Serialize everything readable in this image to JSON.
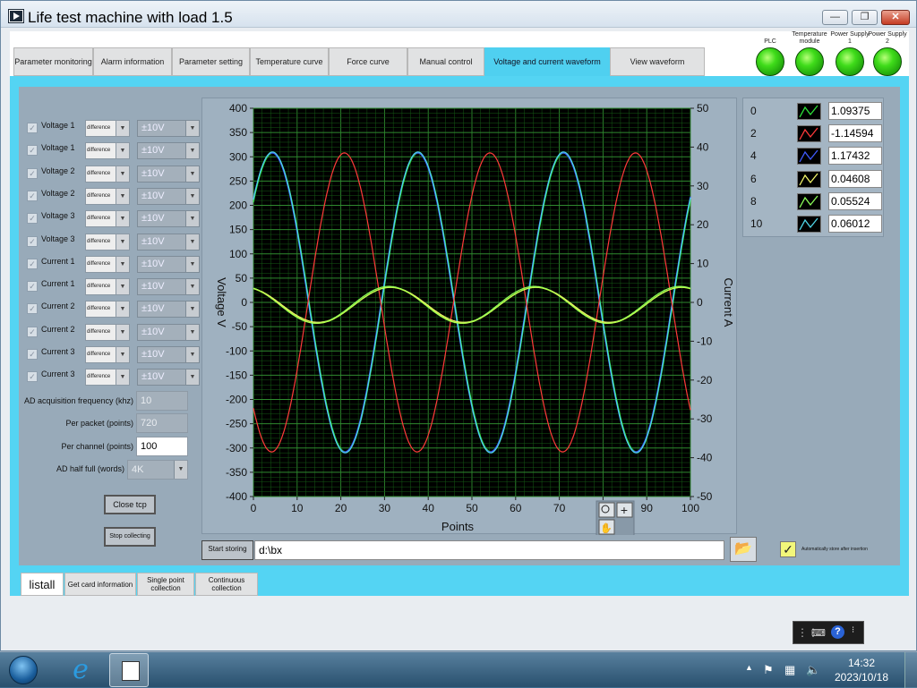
{
  "window": {
    "title": "Life test machine with load 1.5",
    "min": "—",
    "max": "❐",
    "close": "✕"
  },
  "tabs": [
    {
      "label": "Parameter monitoring"
    },
    {
      "label": "Alarm information"
    },
    {
      "label": "Parameter setting"
    },
    {
      "label": "Temperature curve"
    },
    {
      "label": "Force curve"
    },
    {
      "label": "Manual control"
    },
    {
      "label": "Voltage and current waveform"
    },
    {
      "label": "View waveform"
    }
  ],
  "indicators": [
    {
      "label": "PLC",
      "color": "#3fdc1a"
    },
    {
      "label": "Temperature module",
      "color": "#3fdc1a"
    },
    {
      "label": "Power Supply 1",
      "color": "#3fdc1a"
    },
    {
      "label": "Power Supply 2",
      "color": "#3fdc1a"
    }
  ],
  "channels": [
    {
      "label": "Voltage 1",
      "mode": "difference",
      "range": "±10V"
    },
    {
      "label": "Voltage 1",
      "mode": "difference",
      "range": "±10V"
    },
    {
      "label": "Voltage 2",
      "mode": "difference",
      "range": "±10V"
    },
    {
      "label": "Voltage 2",
      "mode": "difference",
      "range": "±10V"
    },
    {
      "label": "Voltage 3",
      "mode": "difference",
      "range": "±10V"
    },
    {
      "label": "Voltage 3",
      "mode": "difference",
      "range": "±10V"
    },
    {
      "label": "Current 1",
      "mode": "difference",
      "range": "±10V"
    },
    {
      "label": "Current 1",
      "mode": "difference",
      "range": "±10V"
    },
    {
      "label": "Current 2",
      "mode": "difference",
      "range": "±10V"
    },
    {
      "label": "Current 2",
      "mode": "difference",
      "range": "±10V"
    },
    {
      "label": "Current 3",
      "mode": "difference",
      "range": "±10V"
    },
    {
      "label": "Current 3",
      "mode": "difference",
      "range": "±10V"
    }
  ],
  "fields": {
    "ad_freq_label": "AD acquisition frequency (khz)",
    "ad_freq": "10",
    "per_packet_label": "Per packet (points)",
    "per_packet": "720",
    "per_channel_label": "Per channel (points)",
    "per_channel": "100",
    "ad_half_label": "AD half full (words)",
    "ad_half": "4K"
  },
  "buttons": {
    "close_tcp": "Close tcp",
    "stop_collecting": "Stop collecting",
    "start_storing": "Start storing"
  },
  "storage": {
    "path": "d:\\bx",
    "auto_label": "Automatically store after insertion",
    "auto_checked": "✓"
  },
  "legend": [
    {
      "key": "0",
      "value": "1.09375",
      "color": "#2ee23a"
    },
    {
      "key": "2",
      "value": "-1.14594",
      "color": "#ff3a3a"
    },
    {
      "key": "4",
      "value": "1.17432",
      "color": "#3f5bff"
    },
    {
      "key": "6",
      "value": "0.04608",
      "color": "#f2f56a"
    },
    {
      "key": "8",
      "value": "0.05524",
      "color": "#8cff5a"
    },
    {
      "key": "10",
      "value": "0.06012",
      "color": "#4fd6e8"
    }
  ],
  "bottom_tabs": [
    {
      "label": "listall"
    },
    {
      "label": "Get card information"
    },
    {
      "label": "Single point collection"
    },
    {
      "label": "Continuous collection"
    }
  ],
  "taskbar": {
    "time": "14:32",
    "date": "2023/10/18"
  },
  "chart_data": {
    "type": "line",
    "xlabel": "Points",
    "ylabel": "Voltage V",
    "y2label": "Current A",
    "xlim": [
      0,
      100
    ],
    "ylim": [
      -400,
      400
    ],
    "y2lim": [
      -50,
      50
    ],
    "xticks": [
      0,
      10,
      20,
      30,
      40,
      50,
      60,
      70,
      80,
      90,
      100
    ],
    "yticks": [
      400,
      350,
      300,
      250,
      200,
      150,
      100,
      50,
      0,
      -50,
      -100,
      -150,
      -200,
      -250,
      -300,
      -350,
      -400
    ],
    "y2ticks": [
      50,
      40,
      30,
      20,
      10,
      0,
      -10,
      -20,
      -30,
      -40,
      -50
    ],
    "grid": true,
    "period_points": 33.3,
    "series": [
      {
        "color": "#2ee23a",
        "amplitude": 308,
        "phase_deg": 42,
        "axis": "left",
        "offset": 0
      },
      {
        "color": "#3f5bff",
        "amplitude": 308,
        "phase_deg": 44,
        "axis": "left",
        "offset": 0
      },
      {
        "color": "#4fd6e8",
        "amplitude": 310,
        "phase_deg": 43,
        "axis": "left",
        "offset": 0
      },
      {
        "color": "#ff3a3a",
        "amplitude": 308,
        "phase_deg": -135,
        "axis": "left",
        "offset": 0
      },
      {
        "color": "#f2f56a",
        "amplitude": 36,
        "phase_deg": 110,
        "axis": "left",
        "offset": -5
      },
      {
        "color": "#8cff5a",
        "amplitude": 38,
        "phase_deg": 115,
        "axis": "left",
        "offset": -5
      },
      {
        "color": "#b8ff4a",
        "amplitude": 37,
        "phase_deg": 112,
        "axis": "left",
        "offset": -6
      }
    ]
  }
}
